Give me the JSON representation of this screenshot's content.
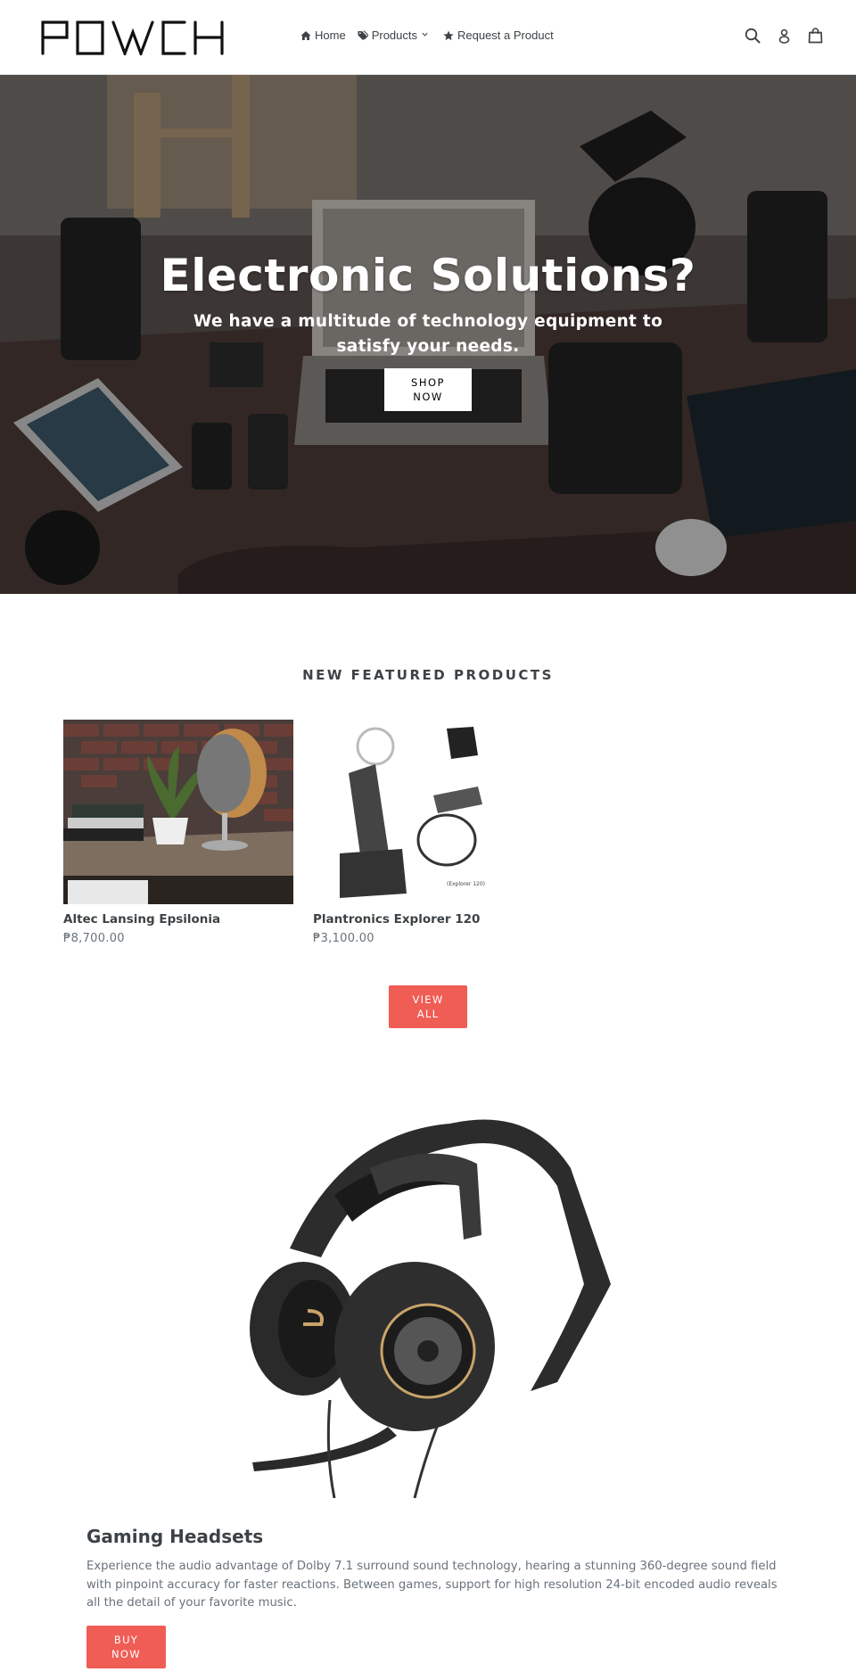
{
  "header": {
    "logo_text": "POWCH",
    "nav": [
      {
        "label": "Home",
        "icon": "home-icon"
      },
      {
        "label": "Products",
        "icon": "tags-icon",
        "has_dropdown": true
      },
      {
        "label": "Request a Product",
        "icon": "star-icon"
      }
    ],
    "icons": [
      "search-icon",
      "account-icon",
      "cart-icon"
    ]
  },
  "hero": {
    "title": "Electronic Solutions?",
    "subtitle": "We have a multitude of technology equipment to satisfy your needs.",
    "button_label": "SHOP NOW"
  },
  "featured": {
    "title": "NEW FEATURED PRODUCTS",
    "products": [
      {
        "name": "Altec Lansing Epsilonia",
        "price": "₱8,700.00"
      },
      {
        "name": "Plantronics Explorer 120",
        "price": "₱3,100.00",
        "image_caption": "(Explorer 120)"
      }
    ],
    "view_all_label": "VIEW ALL"
  },
  "feature": {
    "title": "Gaming Headsets",
    "text": "Experience the audio advantage of Dolby 7.1 surround sound technology, hearing a stunning 360-degree sound field with pinpoint accuracy for faster reactions. Between games, support for high resolution 24-bit encoded audio reveals all the detail of your favorite music.",
    "button_label": "BUY NOW"
  },
  "colors": {
    "accent": "#f05d55",
    "text": "#3d4246",
    "muted": "#69727b"
  }
}
